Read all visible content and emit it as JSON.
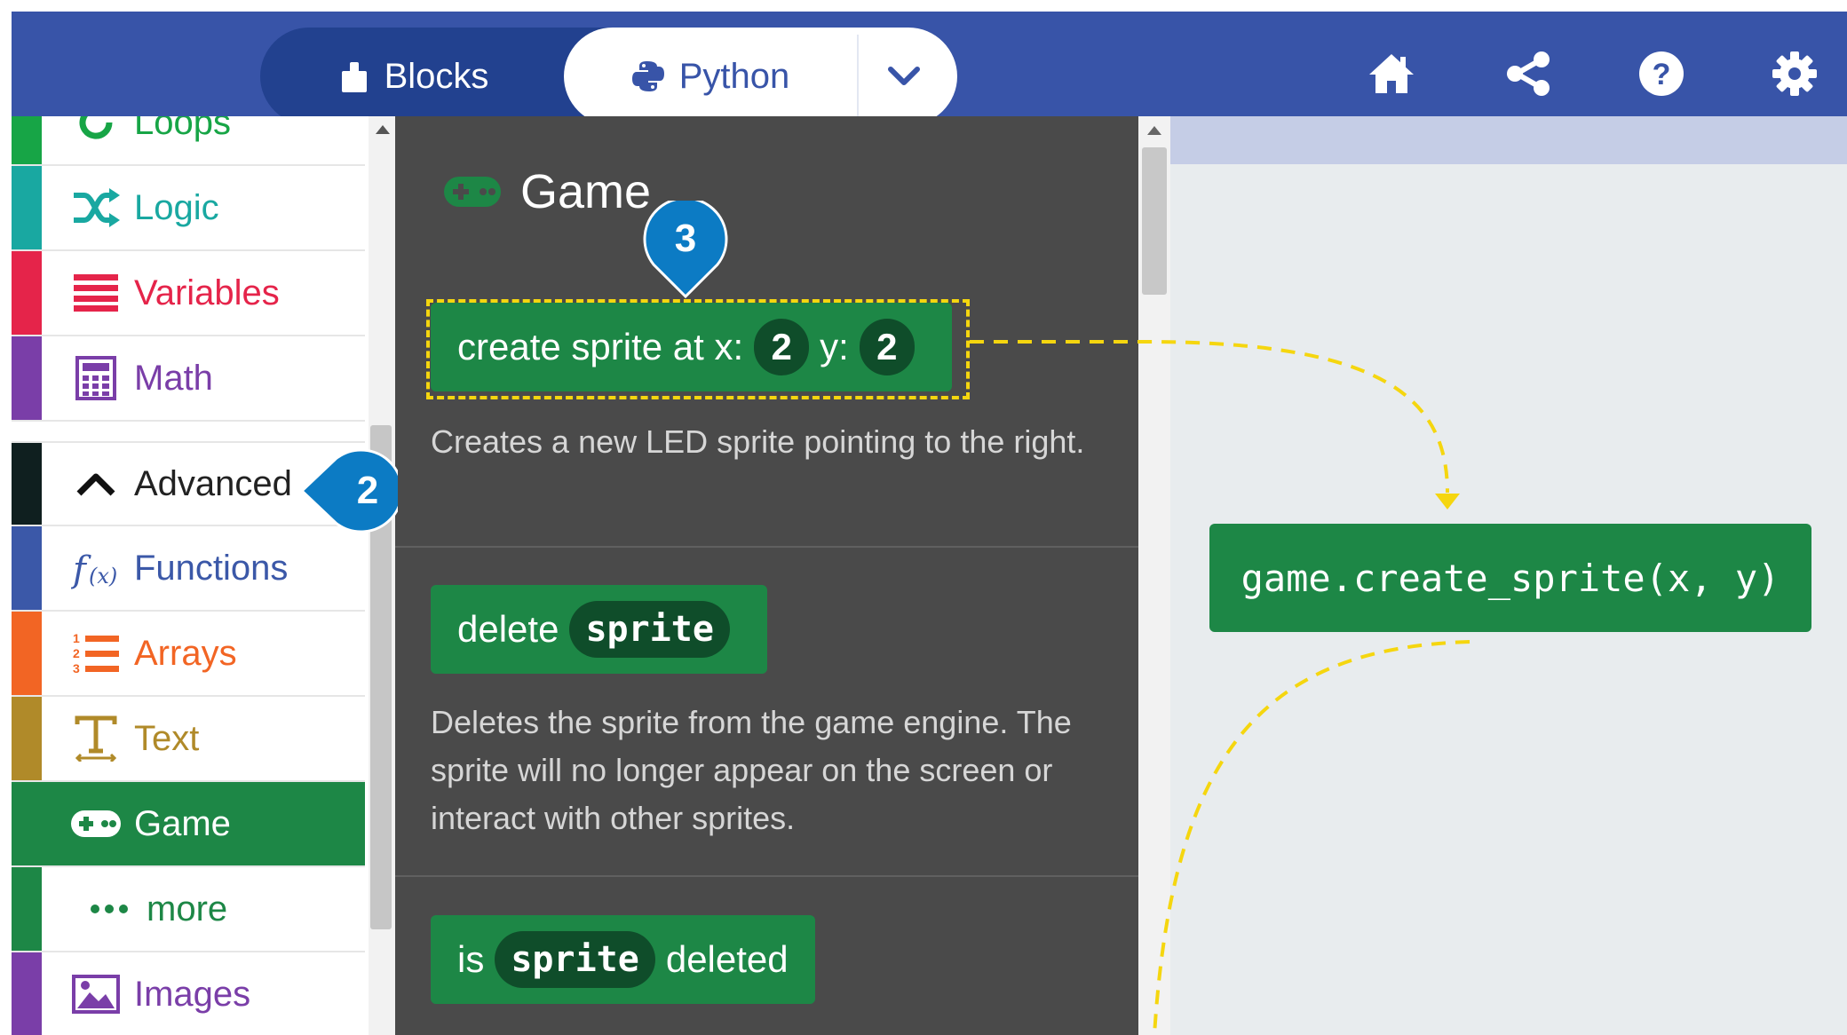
{
  "toolbar": {
    "blocks_label": "Blocks",
    "python_label": "Python",
    "icons": [
      "home-icon",
      "share-icon",
      "help-icon",
      "settings-gear-icon"
    ]
  },
  "sidebar": {
    "categories": [
      {
        "label": "Loops",
        "color": "#17a546",
        "icon": "loops-icon"
      },
      {
        "label": "Logic",
        "color": "#19a8a1",
        "icon": "logic-shuffle-icon"
      },
      {
        "label": "Variables",
        "color": "#e5244a",
        "icon": "variables-lines-icon"
      },
      {
        "label": "Math",
        "color": "#7a3ea8",
        "icon": "math-calculator-icon"
      },
      {
        "label": "Advanced",
        "color": "#0f1f1f",
        "icon": "chevron-up-icon",
        "state": "expanded"
      },
      {
        "label": "Functions",
        "color": "#3b58a8",
        "icon": "functions-fx-icon"
      },
      {
        "label": "Arrays",
        "color": "#f26524",
        "icon": "arrays-list-icon"
      },
      {
        "label": "Text",
        "color": "#b08a29",
        "icon": "text-t-icon"
      },
      {
        "label": "Game",
        "color": "#1d8746",
        "icon": "gamepad-icon",
        "state": "selected"
      },
      {
        "label": "more",
        "color": "#1d8746",
        "icon": "more-dots-icon"
      },
      {
        "label": "Images",
        "color": "#7a3ea8",
        "icon": "images-icon"
      }
    ]
  },
  "flyout": {
    "title": "Game",
    "blocks": [
      {
        "text": "create sprite at x:",
        "x_value": "2",
        "y_label": "y:",
        "y_value": "2",
        "description": "Creates a new LED sprite pointing to the right."
      },
      {
        "text": "delete",
        "param": "sprite",
        "description": "Deletes the sprite from the game engine. The sprite will no longer appear on the screen or interact with other sprites."
      },
      {
        "text_before": "is",
        "param": "sprite",
        "text_after": "deleted"
      }
    ]
  },
  "workspace": {
    "code_block": "game.create_sprite(x, y)"
  },
  "callouts": {
    "step_2": "2",
    "step_3": "3"
  },
  "colors": {
    "toolbar": "#3854a8",
    "block_green": "#1d8746",
    "flyout_bg": "#4a4a4a",
    "highlight_dash": "#f5d60f",
    "callout_blue": "#0c7bc4"
  }
}
